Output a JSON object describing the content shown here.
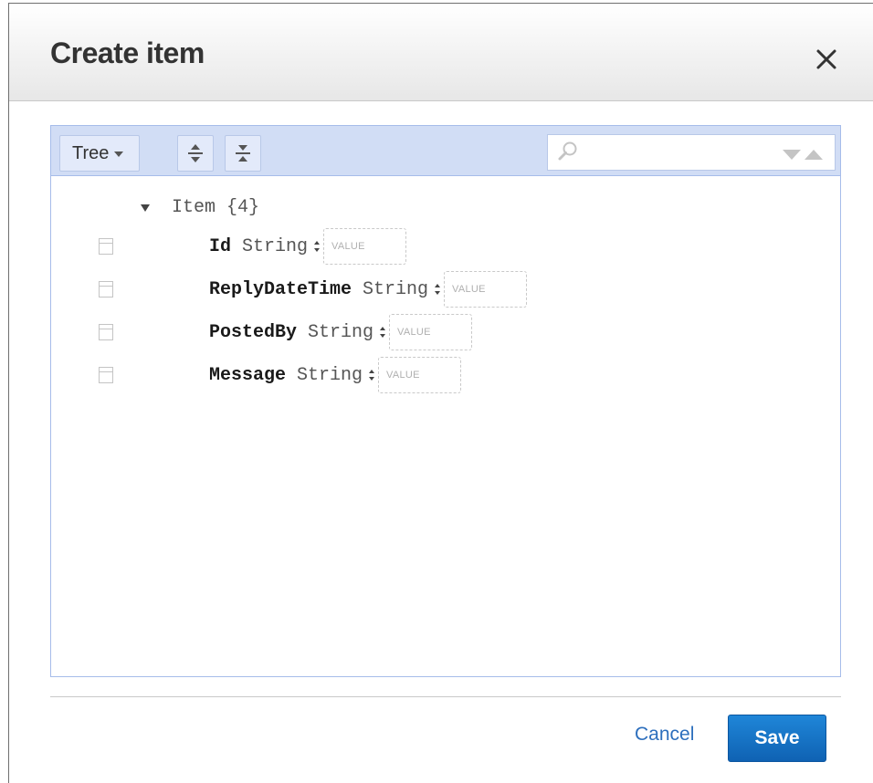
{
  "dialog": {
    "title": "Create item",
    "close_icon": "close-icon"
  },
  "toolbar": {
    "mode_label": "Tree",
    "expand_all_icon": "expand-all-icon",
    "collapse_all_icon": "collapse-all-icon",
    "search": {
      "value": "",
      "placeholder": ""
    }
  },
  "tree": {
    "root_label": "Item {4}",
    "fields": [
      {
        "name": "Id",
        "type": "String",
        "value_placeholder": "VALUE"
      },
      {
        "name": "ReplyDateTime",
        "type": "String",
        "value_placeholder": "VALUE"
      },
      {
        "name": "PostedBy",
        "type": "String",
        "value_placeholder": "VALUE"
      },
      {
        "name": "Message",
        "type": "String",
        "value_placeholder": "VALUE"
      }
    ]
  },
  "footer": {
    "cancel_label": "Cancel",
    "save_label": "Save"
  },
  "colors": {
    "accent": "#1f86d8",
    "toolbar_bg": "#d1ddf5",
    "link": "#2d6fbd"
  }
}
